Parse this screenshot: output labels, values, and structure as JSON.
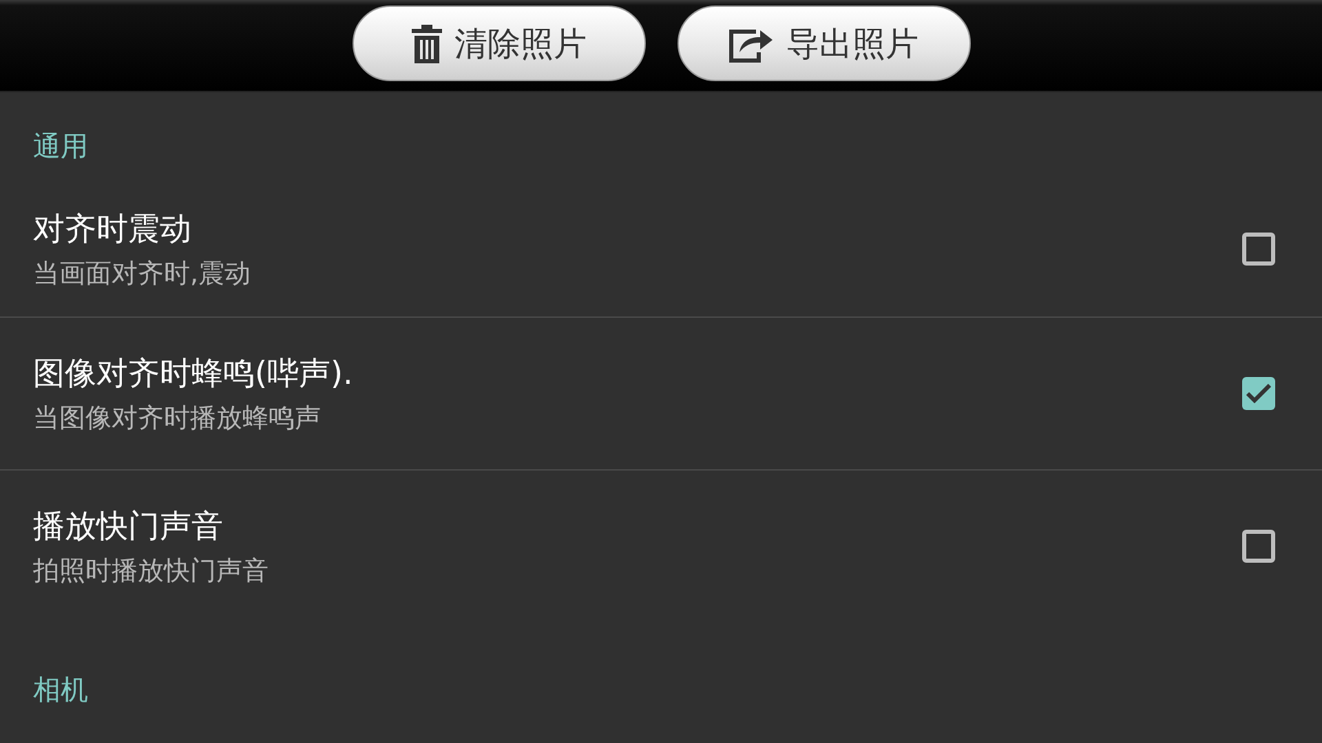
{
  "toolbar": {
    "buttons": [
      {
        "kind": "delete",
        "label": "清除照片"
      },
      {
        "kind": "export",
        "label": "导出照片"
      }
    ]
  },
  "sections": [
    {
      "title": "通用",
      "items": [
        {
          "title": "对齐时震动",
          "summary": "当画面对齐时,震动",
          "checked": false
        },
        {
          "title": "图像对齐时蜂鸣(哔声).",
          "summary": "当图像对齐时播放蜂鸣声",
          "checked": true
        },
        {
          "title": "播放快门声音",
          "summary": "拍照时播放快门声音",
          "checked": false
        }
      ]
    },
    {
      "title": "相机"
    }
  ]
}
